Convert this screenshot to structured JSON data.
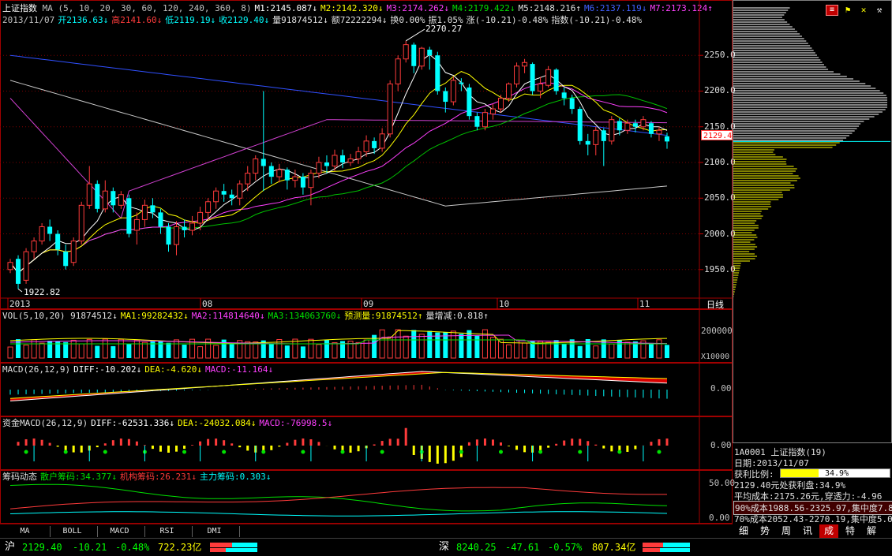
{
  "header": {
    "index_name": "上证指数",
    "ma_line": [
      {
        "text": "MA (5, 10, 20, 30, 60, 120, 240, 360, 8)",
        "color": "#c0c0c0"
      },
      {
        "text": "M1:2145.087↓",
        "color": "#ffffff"
      },
      {
        "text": "M2:2142.320↓",
        "color": "#ffff00"
      },
      {
        "text": "M3:2174.262↓",
        "color": "#ff40ff"
      },
      {
        "text": "M4:2179.422↓",
        "color": "#00e000"
      },
      {
        "text": "M5:2148.216↑",
        "color": "#e0e0e0"
      },
      {
        "text": "M6:2137.119↓",
        "color": "#4060ff"
      },
      {
        "text": "M7:2173.124↑",
        "color": "#ff40ff"
      }
    ],
    "quote_line": [
      {
        "text": "2013/11/07",
        "color": "#c0c0c0"
      },
      {
        "text": "开2136.63↓",
        "color": "#00ffff"
      },
      {
        "text": "高2141.60↓",
        "color": "#ff3b3b"
      },
      {
        "text": "低2119.19↓",
        "color": "#00ffff"
      },
      {
        "text": "收2129.40↓",
        "color": "#00ffff"
      },
      {
        "text": "量91874512↓",
        "color": "#e0e0e0"
      },
      {
        "text": "额72222294↓",
        "color": "#e0e0e0"
      },
      {
        "text": "换0.00%",
        "color": "#e0e0e0"
      },
      {
        "text": "振1.05%",
        "color": "#e0e0e0"
      },
      {
        "text": "涨(-10.21)-0.48%",
        "color": "#e0e0e0"
      },
      {
        "text": "指数(-10.21)-0.48%",
        "color": "#e0e0e0"
      }
    ]
  },
  "main_chart": {
    "y_ticks": [
      "2250.0",
      "2200.0",
      "2150.0",
      "2100.0",
      "2050.0",
      "2000.0",
      "1950.0"
    ],
    "current_price_label": "2129.4",
    "high_label": "2270.27",
    "low_label": "1922.82",
    "x_ticks": [
      "2013",
      "08",
      "09",
      "10",
      "11"
    ],
    "period_label": "日线"
  },
  "chart_data": {
    "type": "candlestick",
    "ylim": [
      1910,
      2290
    ],
    "candles": [
      [
        1950,
        1960,
        1945,
        1965
      ],
      [
        1965,
        1930,
        1922.82,
        1970
      ],
      [
        1935,
        1975,
        1930,
        1980
      ],
      [
        1975,
        1990,
        1965,
        1995
      ],
      [
        1990,
        2010,
        1985,
        2015
      ],
      [
        2010,
        2000,
        1990,
        2020
      ],
      [
        2000,
        1978,
        1970,
        2005
      ],
      [
        1975,
        1955,
        1950,
        1985
      ],
      [
        1960,
        1990,
        1955,
        1995
      ],
      [
        1990,
        2040,
        1985,
        2045
      ],
      [
        2040,
        2070,
        2035,
        2095
      ],
      [
        2070,
        2035,
        2030,
        2075
      ],
      [
        2035,
        2060,
        2030,
        2075
      ],
      [
        2060,
        2040,
        2030,
        2065
      ],
      [
        2040,
        2055,
        2035,
        2060
      ],
      [
        2050,
        2000,
        1995,
        2055
      ],
      [
        2005,
        2020,
        1985,
        2030
      ],
      [
        2020,
        2040,
        2010,
        2048
      ],
      [
        2040,
        2030,
        2022,
        2050
      ],
      [
        2030,
        2010,
        2000,
        2035
      ],
      [
        2010,
        1985,
        1975,
        2015
      ],
      [
        1985,
        2010,
        1970,
        2018
      ],
      [
        2010,
        2005,
        1995,
        2020
      ],
      [
        2005,
        2015,
        1998,
        2025
      ],
      [
        2015,
        2030,
        2005,
        2038
      ],
      [
        2030,
        2045,
        2020,
        2050
      ],
      [
        2045,
        2060,
        2035,
        2065
      ],
      [
        2060,
        2055,
        2045,
        2070
      ],
      [
        2055,
        2050,
        2040,
        2062
      ],
      [
        2050,
        2070,
        2040,
        2075
      ],
      [
        2070,
        2085,
        2060,
        2095
      ],
      [
        2085,
        2105,
        2075,
        2110
      ],
      [
        2105,
        2095,
        2060,
        2200
      ],
      [
        2095,
        2080,
        2070,
        2100
      ],
      [
        2080,
        2090,
        2072,
        2098
      ],
      [
        2090,
        2075,
        2062,
        2093
      ],
      [
        2075,
        2080,
        2065,
        2090
      ],
      [
        2080,
        2065,
        2055,
        2085
      ],
      [
        2065,
        2085,
        2040,
        2090
      ],
      [
        2085,
        2100,
        2078,
        2108
      ],
      [
        2100,
        2095,
        2085,
        2110
      ],
      [
        2095,
        2110,
        2088,
        2118
      ],
      [
        2110,
        2100,
        2092,
        2118
      ],
      [
        2100,
        2105,
        2095,
        2112
      ],
      [
        2105,
        2115,
        2098,
        2122
      ],
      [
        2115,
        2130,
        2108,
        2138
      ],
      [
        2130,
        2120,
        2112,
        2135
      ],
      [
        2120,
        2140,
        2115,
        2148
      ],
      [
        2140,
        2210,
        2135,
        2215
      ],
      [
        2210,
        2245,
        2200,
        2250
      ],
      [
        2245,
        2265,
        2240,
        2270.27
      ],
      [
        2265,
        2235,
        2225,
        2268
      ],
      [
        2235,
        2260,
        2230,
        2262
      ],
      [
        2258,
        2250,
        2230,
        2262
      ],
      [
        2250,
        2200,
        2195,
        2255
      ],
      [
        2200,
        2185,
        2170,
        2205
      ],
      [
        2185,
        2215,
        2180,
        2220
      ],
      [
        2212,
        2210,
        2200,
        2218
      ],
      [
        2205,
        2165,
        2160,
        2210
      ],
      [
        2165,
        2150,
        2145,
        2170
      ],
      [
        2150,
        2170,
        2145,
        2175
      ],
      [
        2168,
        2175,
        2160,
        2182
      ],
      [
        2175,
        2190,
        2170,
        2195
      ],
      [
        2190,
        2210,
        2185,
        2212
      ],
      [
        2210,
        2235,
        2205,
        2240
      ],
      [
        2235,
        2240,
        2225,
        2245
      ],
      [
        2238,
        2200,
        2195,
        2240
      ],
      [
        2200,
        2210,
        2190,
        2220
      ],
      [
        2208,
        2230,
        2205,
        2235
      ],
      [
        2230,
        2200,
        2195,
        2232
      ],
      [
        2198,
        2190,
        2180,
        2205
      ],
      [
        2190,
        2175,
        2168,
        2195
      ],
      [
        2175,
        2130,
        2125,
        2178
      ],
      [
        2130,
        2125,
        2110,
        2140
      ],
      [
        2125,
        2145,
        2110,
        2150
      ],
      [
        2145,
        2130,
        2095,
        2148
      ],
      [
        2130,
        2160,
        2125,
        2165
      ],
      [
        2158,
        2145,
        2138,
        2162
      ],
      [
        2145,
        2155,
        2140,
        2160
      ],
      [
        2155,
        2150,
        2142,
        2160
      ],
      [
        2150,
        2160,
        2145,
        2165
      ],
      [
        2155,
        2140,
        2135,
        2158
      ],
      [
        2140,
        2145,
        2130,
        2150
      ],
      [
        2136.63,
        2129.4,
        2119.19,
        2141.6
      ]
    ]
  },
  "volume_panel": {
    "label_segments": [
      {
        "text": "VOL(5,10,20) 91874512↓",
        "color": "#e0e0e0"
      },
      {
        "text": "MA1:99282432↓",
        "color": "#ffff00"
      },
      {
        "text": "MA2:114814640↓",
        "color": "#ff40ff"
      },
      {
        "text": "MA3:134063760↓",
        "color": "#00e000"
      },
      {
        "text": "预测量:91874512↑",
        "color": "#ffff00"
      },
      {
        "text": "量增减:0.818↑",
        "color": "#e0e0e0"
      }
    ],
    "y_tick": "200000",
    "unit": "X10000"
  },
  "macd_panel": {
    "label_segments": [
      {
        "text": "MACD(26,12,9)",
        "color": "#e0e0e0"
      },
      {
        "text": "DIFF:-10.202↓",
        "color": "#ffffff"
      },
      {
        "text": "DEA:-4.620↓",
        "color": "#ffff00"
      },
      {
        "text": "MACD:-11.164↓",
        "color": "#ff40ff"
      }
    ],
    "y_tick": "0.00"
  },
  "fund_macd_panel": {
    "label_segments": [
      {
        "text": "资金MACD(26,12,9)",
        "color": "#e0e0e0"
      },
      {
        "text": "DIFF:-62531.336↓",
        "color": "#ffffff"
      },
      {
        "text": "DEA:-24032.084↓",
        "color": "#ffff00"
      },
      {
        "text": "MACD:-76998.5↓",
        "color": "#ff40ff"
      }
    ],
    "y_tick": "0.00"
  },
  "chip_panel": {
    "label_segments": [
      {
        "text": "筹码动态",
        "color": "#e0e0e0"
      },
      {
        "text": "散户筹码:34.377↓",
        "color": "#00e000"
      },
      {
        "text": "机构筹码:26.231↓",
        "color": "#ff3b3b"
      },
      {
        "text": "主力筹码:0.303↓",
        "color": "#00ffff"
      }
    ],
    "y_ticks": [
      "50.00",
      "0.00"
    ]
  },
  "tabs": [
    "MA",
    "BOLL",
    "MACD",
    "RSI",
    "DMI"
  ],
  "side_panel": {
    "title": "1A0001 上证指数(19)",
    "date": "日期:2013/11/07",
    "profit_label": "获利比例:",
    "profit_value": "34.9%",
    "profit_fraction": 0.349,
    "lines": [
      "2129.40元处获利盘:34.9%",
      "平均成本:2175.26元,穿透力:-4.96",
      "90%成本1988.56-2325.97,集中度7.8",
      "70%成本2052.43-2270.19,集中度5.0"
    ],
    "buttons": [
      "细",
      "势",
      "周",
      "讯",
      "成",
      "特",
      "解"
    ],
    "icon_buttons": [
      "menu-icon",
      "flag-icon",
      "cross-icon",
      "tool-icon"
    ]
  },
  "status_bar": {
    "sh_label": "沪",
    "sh_price": "2129.40",
    "sh_change": "-10.21",
    "sh_pct": "-0.48%",
    "sh_amount": "722.23亿",
    "sz_label": "深",
    "sz_price": "8240.25",
    "sz_change": "-47.61",
    "sz_pct": "-0.57%",
    "sz_amount": "807.34亿"
  },
  "colors": {
    "up": "#ff3b3b",
    "down": "#00ffff",
    "border": "#a00000",
    "grid": "#800000"
  }
}
